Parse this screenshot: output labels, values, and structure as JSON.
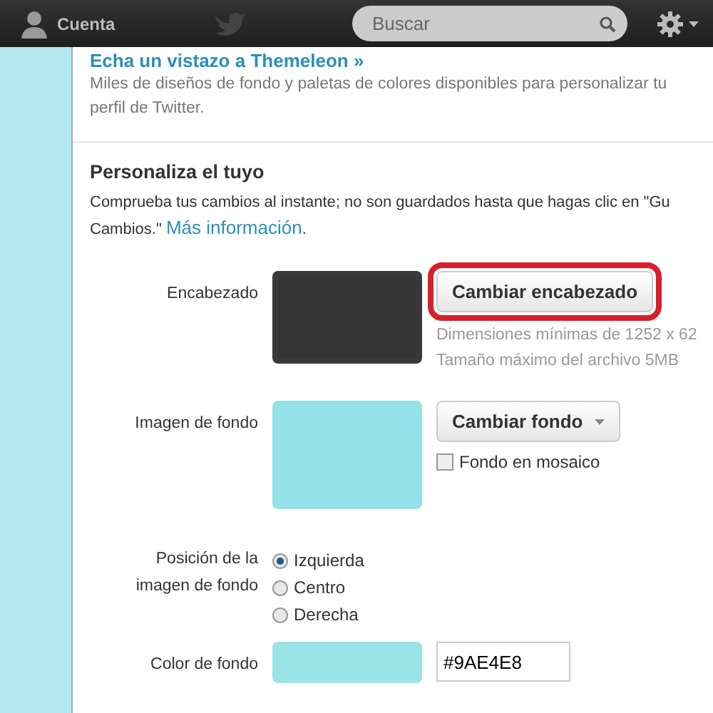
{
  "topbar": {
    "account": "Cuenta",
    "search": {
      "placeholder": "Buscar"
    }
  },
  "promo": {
    "link": "Echa un vistazo a Themeleon »",
    "text": "Miles de diseños de fondo y paletas de colores disponibles para personalizar tu perfil de Twitter."
  },
  "section": {
    "title": "Personaliza el tuyo",
    "lines": [
      "Comprueba tus cambios al instante; no son guardados hasta que hagas clic en \"Gu",
      "Cambios.\""
    ],
    "link": "Más información",
    "after_link": "."
  },
  "header_row": {
    "label": "Encabezado",
    "button": "Cambiar encabezado",
    "highlighted": true,
    "hints": [
      "Dimensiones mínimas de 1252 x 62",
      "Tamaño máximo del archivo 5MB"
    ]
  },
  "background_row": {
    "label": "Imagen de fondo",
    "button": "Cambiar fondo",
    "tile": {
      "label": "Fondo en mosaico",
      "checked": false
    }
  },
  "position_row": {
    "label": "Posición de la imagen de fondo",
    "options": [
      {
        "label": "Izquierda",
        "selected": true
      },
      {
        "label": "Centro",
        "selected": false
      },
      {
        "label": "Derecha",
        "selected": false
      }
    ]
  },
  "color_row": {
    "label": "Color de fondo",
    "value": "#9AE4E8"
  }
}
